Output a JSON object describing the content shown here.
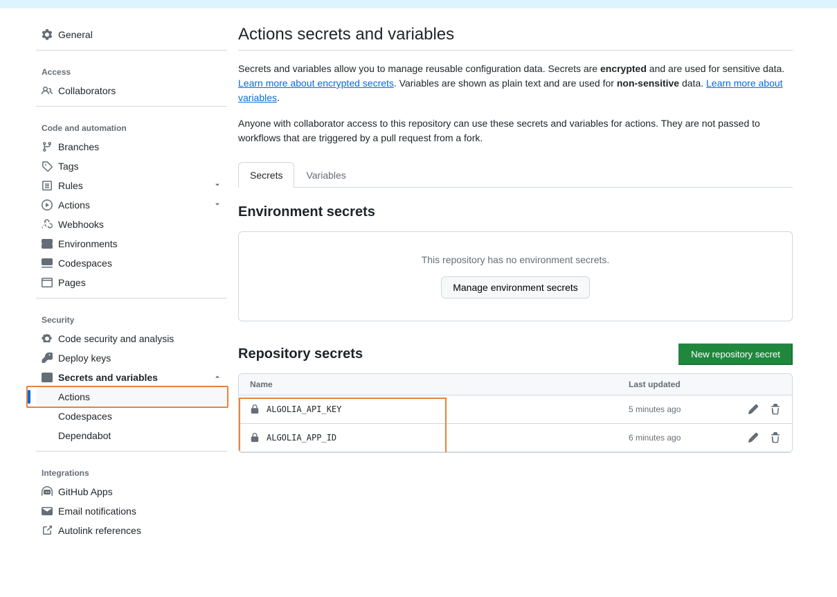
{
  "sidebar": {
    "general": "General",
    "sections": {
      "access": "Access",
      "code_automation": "Code and automation",
      "security": "Security",
      "integrations": "Integrations"
    },
    "items": {
      "collaborators": "Collaborators",
      "branches": "Branches",
      "tags": "Tags",
      "rules": "Rules",
      "actions": "Actions",
      "webhooks": "Webhooks",
      "environments": "Environments",
      "codespaces": "Codespaces",
      "pages": "Pages",
      "code_security": "Code security and analysis",
      "deploy_keys": "Deploy keys",
      "secrets_variables": "Secrets and variables",
      "sv_actions": "Actions",
      "sv_codespaces": "Codespaces",
      "sv_dependabot": "Dependabot",
      "github_apps": "GitHub Apps",
      "email_notifications": "Email notifications",
      "autolink_refs": "Autolink references"
    }
  },
  "main": {
    "title": "Actions secrets and variables",
    "desc_1_a": "Secrets and variables allow you to manage reusable configuration data. Secrets are ",
    "desc_1_b": "encrypted",
    "desc_1_c": " and are used for sensitive data. ",
    "link_secrets": "Learn more about encrypted secrets",
    "desc_1_d": ". Variables are shown as plain text and are used for ",
    "desc_1_e": "non-sensitive",
    "desc_1_f": " data. ",
    "link_vars": "Learn more about variables",
    "desc_1_g": ".",
    "desc_2": "Anyone with collaborator access to this repository can use these secrets and variables for actions. They are not passed to workflows that are triggered by a pull request from a fork.",
    "tabs": {
      "secrets": "Secrets",
      "variables": "Variables"
    },
    "env_section_title": "Environment secrets",
    "env_empty_text": "This repository has no environment secrets.",
    "env_manage_btn": "Manage environment secrets",
    "repo_section_title": "Repository secrets",
    "new_secret_btn": "New repository secret",
    "table": {
      "col_name": "Name",
      "col_updated": "Last updated",
      "rows": [
        {
          "name": "ALGOLIA_API_KEY",
          "updated": "5 minutes ago"
        },
        {
          "name": "ALGOLIA_APP_ID",
          "updated": "6 minutes ago"
        }
      ]
    }
  }
}
